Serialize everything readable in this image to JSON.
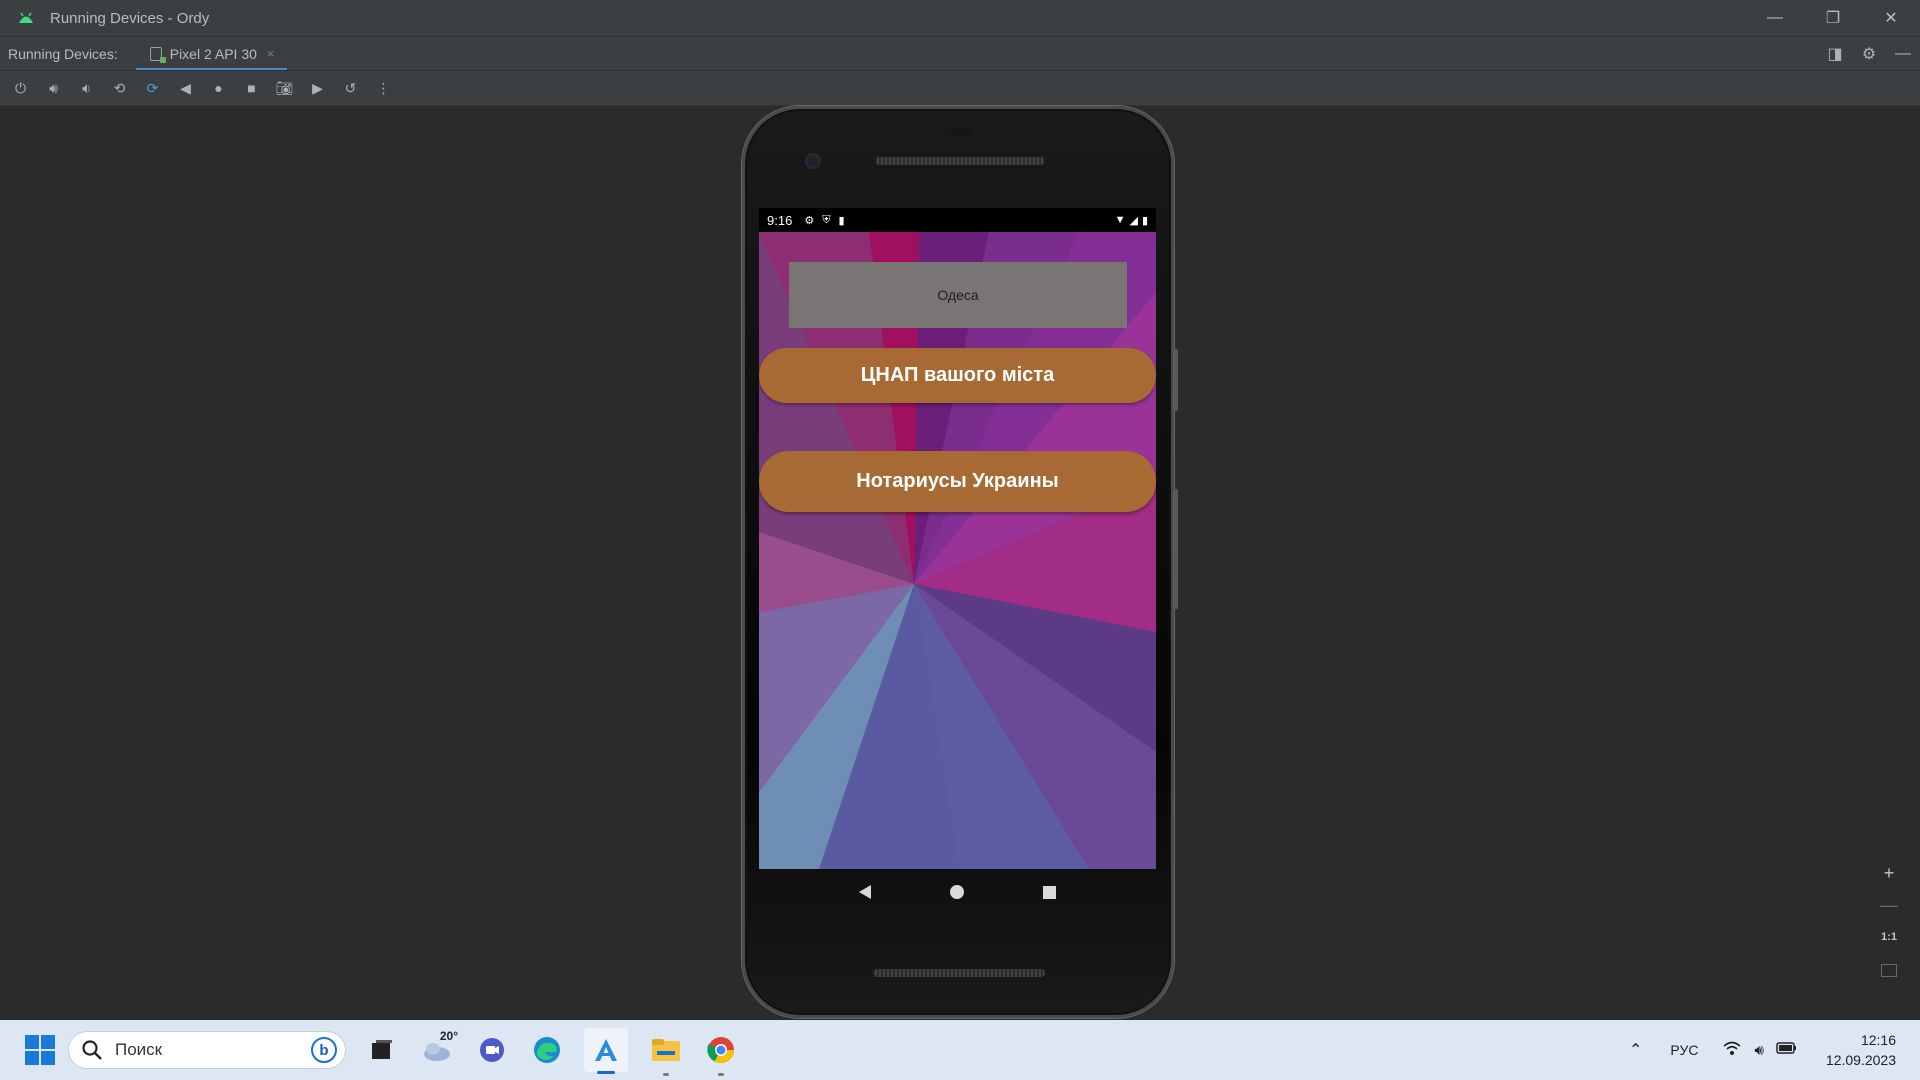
{
  "window": {
    "title": "Running Devices - Ordy",
    "controls": {
      "minimize": "—",
      "restore": "❐",
      "close": "✕"
    }
  },
  "tool_window": {
    "label": "Running Devices:",
    "device_tab": {
      "label": "Pixel 2 API 30",
      "close": "×"
    }
  },
  "toolbar": {
    "buttons": [
      "power-icon",
      "volume-up-icon",
      "volume-down-icon",
      "rotate-left-icon",
      "rotate-right-icon",
      "back-icon",
      "home-icon",
      "overview-icon",
      "screenshot-icon",
      "screen-record-icon",
      "snapshot-icon",
      "more-icon"
    ]
  },
  "device": {
    "status": {
      "time": "9:16"
    },
    "app": {
      "city": "Одеса",
      "buttons": [
        "ЦНАП вашого міста",
        "Нотариусы Украины"
      ]
    }
  },
  "zoom": {
    "plus": "+",
    "minus": "—",
    "actual": "1:1"
  },
  "taskbar": {
    "search_placeholder": "Поиск",
    "weather_temp": "20°",
    "tray": {
      "language": "РУС",
      "time": "12:16",
      "date": "12.09.2023"
    }
  }
}
